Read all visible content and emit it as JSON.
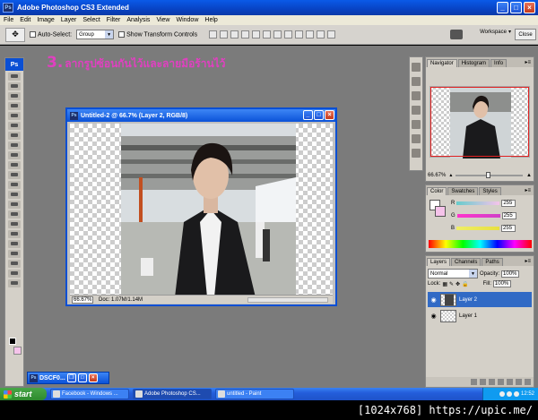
{
  "app": {
    "title": "Adobe Photoshop CS3 Extended",
    "logo": "Ps"
  },
  "menu": [
    "File",
    "Edit",
    "Image",
    "Layer",
    "Select",
    "Filter",
    "Analysis",
    "View",
    "Window",
    "Help"
  ],
  "options": {
    "auto_select_label": "Auto-Select:",
    "auto_select_value": "Group",
    "show_transform_label": "Show Transform Controls",
    "workspace_label": "Workspace",
    "close_label": "Close"
  },
  "caption": {
    "number": "3.",
    "text": "ลากรูปซ้อนกันไว้และลายมือร้านไว้"
  },
  "document": {
    "title": "Untitled-2 @ 66.7% (Layer 2, RGB/8)",
    "zoom": "66.67%",
    "doc_size": "Doc: 1.07M/1.14M"
  },
  "navigator": {
    "tabs": [
      "Navigator",
      "Histogram",
      "Info"
    ],
    "zoom": "66.67%"
  },
  "color": {
    "tabs": [
      "Color",
      "Swatches",
      "Styles"
    ],
    "channels": [
      {
        "label": "R",
        "value": "255",
        "color": "#f5c3ea"
      },
      {
        "label": "G",
        "value": "255",
        "color": "#d040c8"
      },
      {
        "label": "B",
        "value": "255",
        "color": "#e8e040"
      }
    ]
  },
  "layers": {
    "tabs": [
      "Layers",
      "Channels",
      "Paths"
    ],
    "blend_mode": "Normal",
    "opacity_label": "Opacity:",
    "opacity_value": "100%",
    "lock_label": "Lock:",
    "fill_label": "Fill:",
    "fill_value": "100%",
    "items": [
      {
        "name": "Layer 2",
        "selected": true
      },
      {
        "name": "Layer 1",
        "selected": false
      }
    ]
  },
  "minimized_doc": {
    "title": "DSCF0..."
  },
  "taskbar": {
    "start_label": "start",
    "tasks": [
      {
        "label": "Facebook - Windows ..."
      },
      {
        "label": "Adobe Photoshop CS..."
      },
      {
        "label": "untitled - Paint"
      }
    ],
    "clock": "12:52"
  },
  "watermark": "[1024x768] https://upic.me/"
}
